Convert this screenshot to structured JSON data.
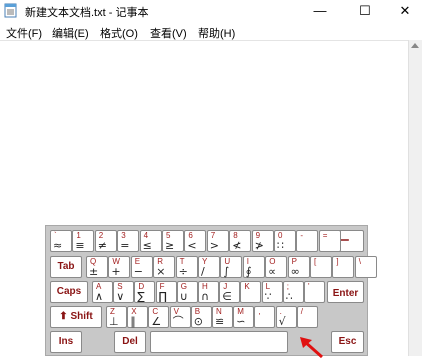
{
  "window": {
    "title": "新建文本文档.txt - 记事本",
    "controls": {
      "minimize": "—",
      "maximize": "☐",
      "close": "✕"
    }
  },
  "menu": [
    "文件(F)",
    "编辑(E)",
    "格式(O)",
    "查看(V)",
    "帮助(H)"
  ],
  "keyboard": {
    "row1": [
      {
        "top": "`",
        "sym": "≈"
      },
      {
        "top": "1",
        "sym": "≡"
      },
      {
        "top": "2",
        "sym": "≠"
      },
      {
        "top": "3",
        "sym": "="
      },
      {
        "top": "4",
        "sym": "≤"
      },
      {
        "top": "5",
        "sym": "≥"
      },
      {
        "top": "6",
        "sym": "<"
      },
      {
        "top": "7",
        "sym": ">"
      },
      {
        "top": "8",
        "sym": "≮"
      },
      {
        "top": "9",
        "sym": "≯"
      },
      {
        "top": "0",
        "sym": "∷"
      },
      {
        "top": "-",
        "sym": ""
      },
      {
        "top": "=",
        "sym": ""
      }
    ],
    "row2": [
      {
        "top": "Q",
        "sym": "±"
      },
      {
        "top": "W",
        "sym": "+"
      },
      {
        "top": "E",
        "sym": "−"
      },
      {
        "top": "R",
        "sym": "×"
      },
      {
        "top": "T",
        "sym": "÷"
      },
      {
        "top": "Y",
        "sym": "/"
      },
      {
        "top": "U",
        "sym": "∫"
      },
      {
        "top": "I",
        "sym": "∮"
      },
      {
        "top": "O",
        "sym": "∝"
      },
      {
        "top": "P",
        "sym": "∞"
      },
      {
        "top": "[",
        "sym": ""
      },
      {
        "top": "]",
        "sym": ""
      },
      {
        "top": "\\",
        "sym": ""
      }
    ],
    "row3": [
      {
        "top": "A",
        "sym": "∧"
      },
      {
        "top": "S",
        "sym": "∨"
      },
      {
        "top": "D",
        "sym": "∑"
      },
      {
        "top": "F",
        "sym": "∏"
      },
      {
        "top": "G",
        "sym": "∪"
      },
      {
        "top": "H",
        "sym": "∩"
      },
      {
        "top": "J",
        "sym": "∈"
      },
      {
        "top": "K",
        "sym": ""
      },
      {
        "top": "L",
        "sym": "∵"
      },
      {
        "top": ";",
        "sym": "∴"
      },
      {
        "top": "'",
        "sym": ""
      }
    ],
    "row4": [
      {
        "top": "Z",
        "sym": "⊥"
      },
      {
        "top": "X",
        "sym": "∥"
      },
      {
        "top": "C",
        "sym": "∠"
      },
      {
        "top": "V",
        "sym": "⌒"
      },
      {
        "top": "B",
        "sym": "⊙"
      },
      {
        "top": "N",
        "sym": "≌"
      },
      {
        "top": "M",
        "sym": "∽"
      },
      {
        "top": ",",
        "sym": ""
      },
      {
        "top": ".",
        "sym": "√"
      },
      {
        "top": "/",
        "sym": ""
      }
    ],
    "backspace": "⟵",
    "tab": "Tab",
    "caps": "Caps",
    "enter": "Enter",
    "shift": "Shift",
    "ins": "Ins",
    "del": "Del",
    "esc": "Esc"
  },
  "colors": {
    "accent_red": "#8a1414",
    "arrow_red": "#e01010"
  }
}
